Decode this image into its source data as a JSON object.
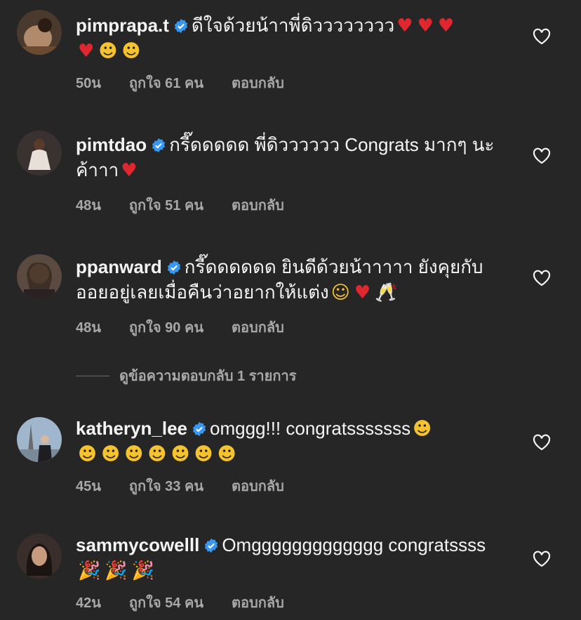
{
  "comments": [
    {
      "username": "pimprapa.t",
      "text": "ดีใจด้วยน้าาพี่ดิวววววววว",
      "emojis": [
        "heart",
        "heart",
        "heart",
        "heart",
        "heart-eyes",
        "heart-eyes"
      ],
      "time": "50น",
      "likes": "ถูกใจ 61 คน",
      "reply": "ตอบกลับ"
    },
    {
      "username": "pimtdao",
      "text": "กรี๊ดดดดด พี่ดิวววววว Congrats มากๆ นะค้าาา",
      "emojis": [
        "heart"
      ],
      "time": "48น",
      "likes": "ถูกใจ 51 คน",
      "reply": "ตอบกลับ"
    },
    {
      "username": "ppanward",
      "text": "กรี๊ดดดดดด ยินดีด้วยน้าาาาา ยังคุยกับออยอยู่เลยเมื่อคืนว่าอยากให้แต่ง",
      "emojis": [
        "smiling-face",
        "heart",
        "clinking-glasses"
      ],
      "time": "48น",
      "likes": "ถูกใจ 90 คน",
      "reply": "ตอบกลับ"
    },
    {
      "username": "katheryn_lee",
      "text": "omggg!!! congratsssssss",
      "emojis": [
        "heart-eyes",
        "heart-eyes",
        "heart-eyes",
        "heart-eyes",
        "heart-eyes",
        "heart-eyes",
        "heart-eyes",
        "heart-eyes"
      ],
      "time": "45น",
      "likes": "ถูกใจ 33 คน",
      "reply": "ตอบกลับ"
    },
    {
      "username": "sammycowelll",
      "text": "Omggggggggggggg congratssss",
      "emojis": [
        "party-popper",
        "party-popper",
        "party-popper"
      ],
      "time": "42น",
      "likes": "ถูกใจ 54 คน",
      "reply": "ตอบกลับ"
    }
  ],
  "view_replies": "ดูข้อความตอบกลับ 1 รายการ",
  "colors": {
    "background": "#262626",
    "text": "#f5f5f5",
    "muted": "#a8a8a8",
    "verified": "#3897f0",
    "heart_emoji": "#e0262f"
  }
}
